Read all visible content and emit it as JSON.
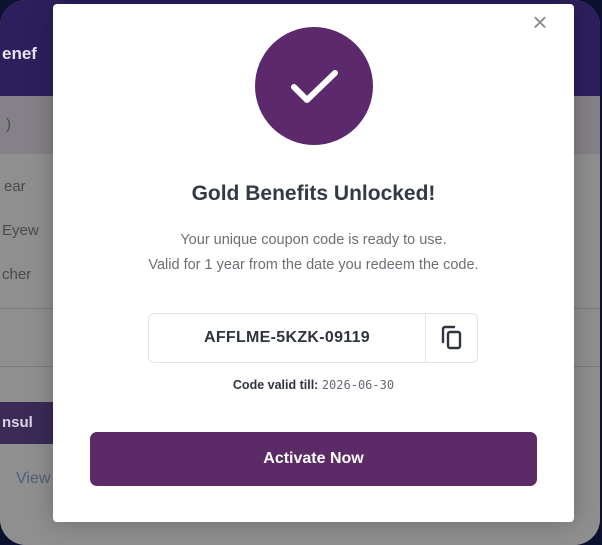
{
  "background_app": {
    "header_title": "enef",
    "row1_text": ")",
    "row2_text": "ear",
    "row3_text": "Eyew",
    "row4_text": "cher",
    "consult_button": "nsul",
    "view_link": "View"
  },
  "modal": {
    "close_icon": "×",
    "title": "Gold Benefits Unlocked!",
    "message_line1": "Your unique coupon code is ready to use.",
    "message_line2": "Valid for 1 year from the date you redeem the code.",
    "coupon_code": "AFFLME-5KZK-09119",
    "valid_label": "Code valid till:",
    "valid_date": "2026-06-30",
    "activate_button": "Activate Now"
  },
  "colors": {
    "brand_purple": "#5c2a66",
    "header_navy": "#2d1f5e"
  },
  "icons": [
    "check-icon",
    "copy-icon",
    "close-icon"
  ]
}
